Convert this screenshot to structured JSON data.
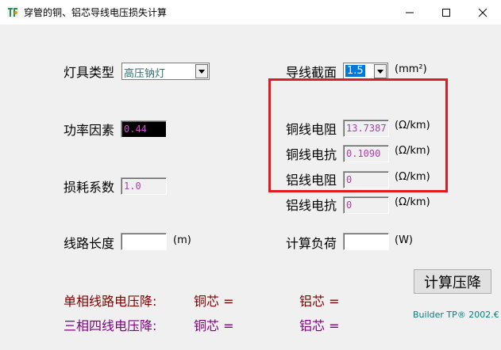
{
  "window": {
    "title": "穿管的铜、铝芯导线电压损失计算"
  },
  "labels": {
    "lamp_type": "灯具类型",
    "wire_section": "导线截面",
    "power_factor": "功率因素",
    "copper_resistance": "铜线电阻",
    "copper_reactance": "铜线电抗",
    "aluminum_resistance": "铝线电阻",
    "aluminum_reactance": "铝线电抗",
    "loss_factor": "损耗系数",
    "line_length": "线路长度",
    "calc_load": "计算负荷"
  },
  "units": {
    "section": "(mm²)",
    "ohm_km_1": "(Ω/km)",
    "ohm_km_2": "(Ω/km)",
    "ohm_km_3": "(Ω/km)",
    "ohm_km_4": "(Ω/km)",
    "meter": "(m)",
    "watt": "(W)"
  },
  "values": {
    "lamp_type": "高压钠灯",
    "wire_section": "1.5",
    "power_factor": "0.44",
    "copper_resistance": "13.7387",
    "copper_reactance": "0.1090",
    "aluminum_resistance": "0",
    "aluminum_reactance": "0",
    "loss_factor": "1.0",
    "line_length": "",
    "calc_load": ""
  },
  "results": {
    "single_phase_label": "单相线路电压降:",
    "three_phase_label": "三相四线电压降:",
    "copper_label_1": "铜芯 =",
    "aluminum_label_1": "铝芯 =",
    "copper_label_2": "铜芯 =",
    "aluminum_label_2": "铝芯 ="
  },
  "buttons": {
    "calculate": "计算压降"
  },
  "footer": {
    "credit": "Builder TP® 2002.€"
  },
  "colors": {
    "highlight_box": "#e01b24",
    "result_single": "#800000",
    "result_three": "#800080",
    "field_text": "#b03cb0"
  }
}
